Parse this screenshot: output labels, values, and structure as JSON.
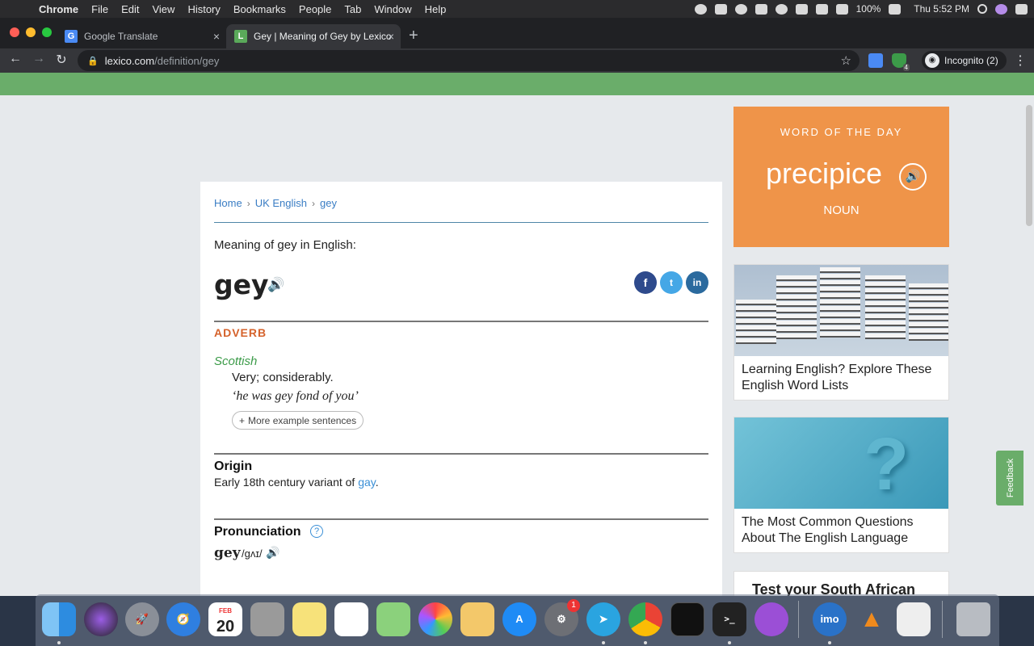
{
  "menubar": {
    "apple": "",
    "items": [
      "Chrome",
      "File",
      "Edit",
      "View",
      "History",
      "Bookmarks",
      "People",
      "Tab",
      "Window",
      "Help"
    ],
    "battery": "100%",
    "clock": "Thu 5:52 PM"
  },
  "tabs": [
    {
      "title": "Google Translate",
      "favicon": "G"
    },
    {
      "title": "Gey | Meaning of Gey by Lexico",
      "favicon": "L"
    }
  ],
  "address": {
    "domain": "lexico.com",
    "path": "/definition/gey"
  },
  "incognito": "Incognito (2)",
  "extension_badge": "4",
  "breadcrumb": {
    "home": "Home",
    "section": "UK English",
    "word": "gey",
    "separator": "›"
  },
  "entry": {
    "meaning_heading": "Meaning of gey in English:",
    "headword": "gey",
    "part_of_speech": "ADVERB",
    "register": "Scottish",
    "definition": "Very; considerably.",
    "example": "‘he was gey fond of you’",
    "more_examples": "More example sentences",
    "origin_title": "Origin",
    "origin_text": "Early 18th century variant of ",
    "origin_link": "gay",
    "origin_end": ".",
    "pronunciation_title": "Pronunciation",
    "pron_word": "gey",
    "pron_ipa": "/ɡʌɪ/"
  },
  "share": {
    "facebook": "f",
    "twitter": "t",
    "linkedin": "in"
  },
  "sidebar": {
    "wotd_label": "WORD OF THE DAY",
    "wotd_word": "precipice",
    "wotd_pos": "NOUN",
    "promo1": "Learning English? Explore These English Word Lists",
    "promo2": "The Most Common Questions About The English Language",
    "promo3": "Test your South African"
  },
  "feedback": "Feedback",
  "dock": {
    "calendar_month": "FEB",
    "calendar_day": "20",
    "settings_badge": "1",
    "imo_label": "imo"
  },
  "colors": {
    "brand_green": "#6aad6a",
    "wotd_orange": "#ef9449",
    "pos_orange": "#d5622b",
    "link_blue": "#3a8fd6",
    "register_green": "#3c9b49"
  }
}
